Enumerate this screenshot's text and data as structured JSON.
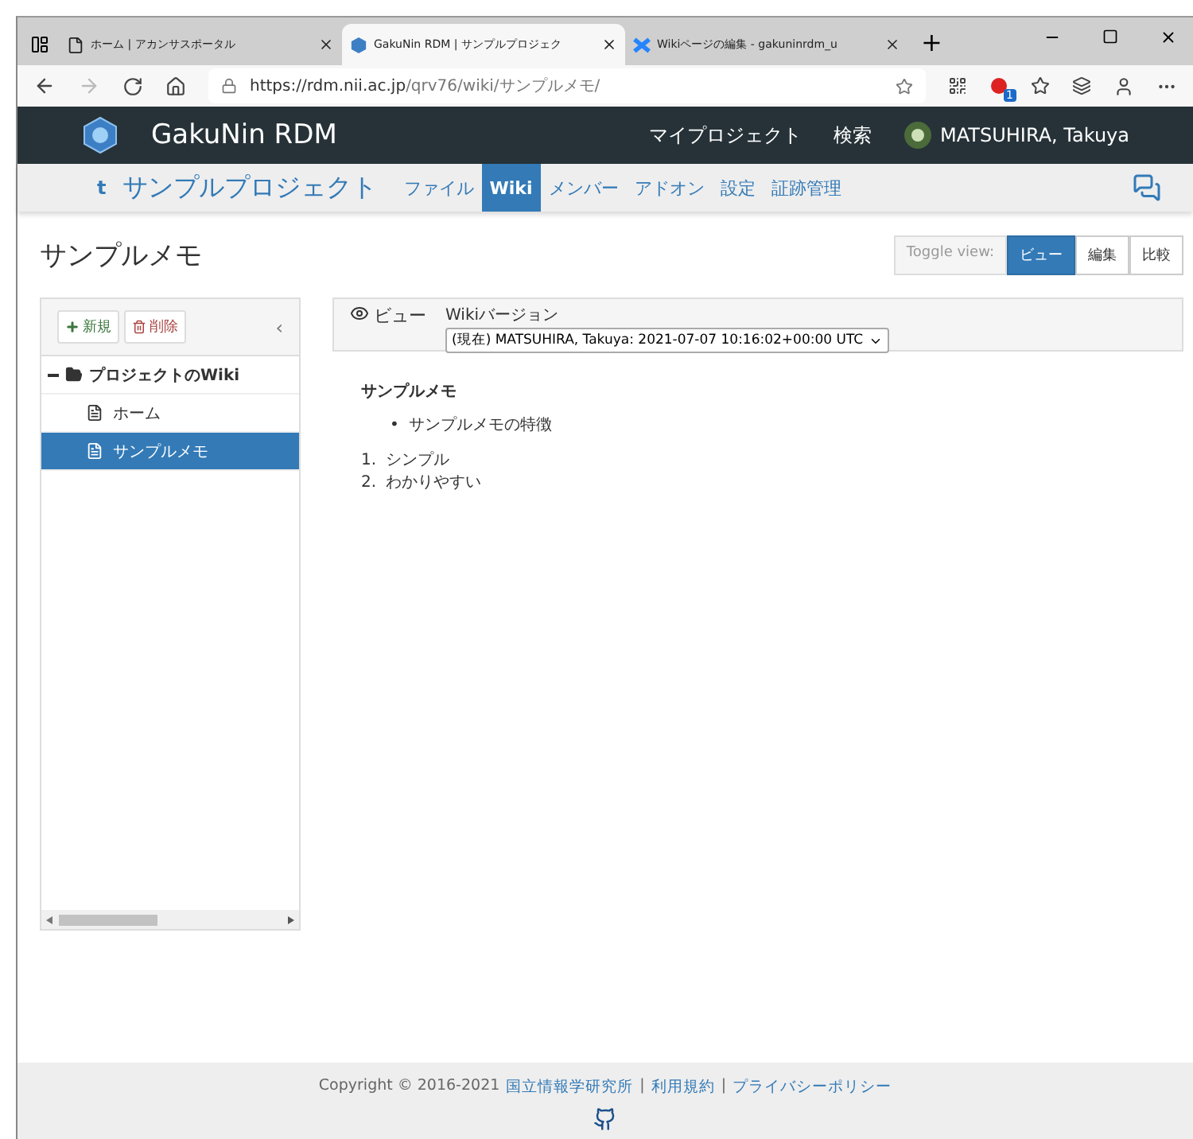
{
  "browser": {
    "tabs": [
      {
        "title": "ホーム | アカンサスポータル",
        "selected": false,
        "kind": "page"
      },
      {
        "title": "GakuNin RDM | サンプルプロジェク",
        "selected": true,
        "kind": "gakunin"
      },
      {
        "title": "Wikiページの編集 - gakuninrdm_u",
        "selected": false,
        "kind": "confluence"
      }
    ],
    "new_tab": "+",
    "url_host": "https://rdm.nii.ac.jp",
    "url_path": "/qrv76/wiki/サンプルメモ/",
    "badge": "1"
  },
  "navbar": {
    "brand": "GakuNin RDM",
    "links": [
      "マイプロジェクト",
      "検索"
    ],
    "user": "MATSUHIRA, Takuya"
  },
  "project_nav": {
    "icon_text": "t",
    "title": "サンプルプロジェクト",
    "items": [
      {
        "label": "ファイル",
        "selected": false
      },
      {
        "label": "Wiki",
        "selected": true
      },
      {
        "label": "メンバー",
        "selected": false
      },
      {
        "label": "アドオン",
        "selected": false
      },
      {
        "label": "設定",
        "selected": false
      },
      {
        "label": "証跡管理",
        "selected": false
      }
    ]
  },
  "page_title": "サンプルメモ",
  "toggle_view": {
    "label": "Toggle view:",
    "buttons": [
      {
        "label": "ビュー",
        "selected": true
      },
      {
        "label": "編集",
        "selected": false
      },
      {
        "label": "比較",
        "selected": false
      }
    ]
  },
  "sidebar": {
    "new_button": "新規",
    "delete_button": "削除",
    "collapse": "‹",
    "tree": {
      "label": "プロジェクトのWiki",
      "expanded": true,
      "children": [
        {
          "label": "ホーム",
          "selected": false
        },
        {
          "label": "サンプルメモ",
          "selected": true
        }
      ]
    }
  },
  "view_panel": {
    "label": "ビュー",
    "version_label": "Wikiバージョン",
    "version_value": "(現在) MATSUHIRA, Takuya: 2021-07-07 10:16:02+00:00 UTC"
  },
  "content": {
    "heading": "サンプルメモ",
    "bullets": [
      {
        "marker": "•",
        "text": "サンプルメモの特徴"
      }
    ],
    "numbered": [
      {
        "marker": "1.",
        "text": "シンプル"
      },
      {
        "marker": "2.",
        "text": "わかりやすい"
      }
    ]
  },
  "footer": {
    "copyright": "Copyright © 2016-2021",
    "links": [
      "国立情報学研究所",
      "利用規約",
      "プライバシーポリシー"
    ],
    "separator": "|"
  }
}
